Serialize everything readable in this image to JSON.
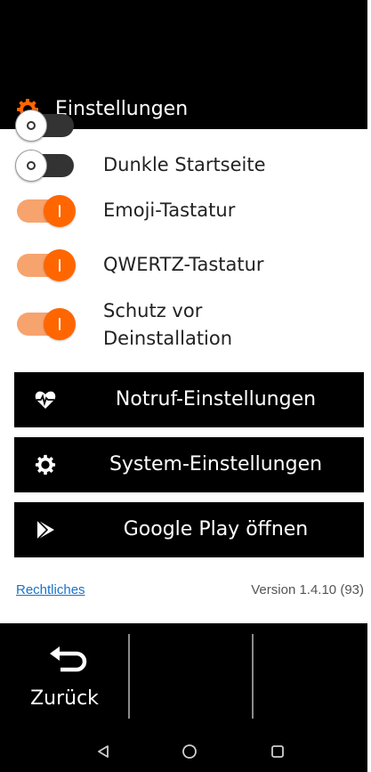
{
  "header": {
    "title": "Einstellungen",
    "icon": "gear-icon",
    "accent": "#ff6600"
  },
  "settings": {
    "items": [
      {
        "label": "Dunkle Startseite",
        "state": "off"
      },
      {
        "label": "Emoji-Tastatur",
        "state": "on"
      },
      {
        "label": "QWERTZ-Tastatur",
        "state": "on"
      },
      {
        "label": "Schutz vor",
        "label2": "Deinstallation",
        "state": "on"
      }
    ]
  },
  "buttons": {
    "emergency": {
      "label": "Notruf-Einstellungen",
      "icon": "heart-pulse-icon"
    },
    "system": {
      "label": "System-Einstellungen",
      "icon": "gear-icon"
    },
    "play": {
      "label": "Google Play öffnen",
      "icon": "play-store-icon"
    }
  },
  "footer": {
    "legal": "Rechtliches",
    "version": "Version 1.4.10 (93)"
  },
  "nav": {
    "back_label": "Zurück"
  },
  "colors": {
    "toggle_on_track": "#f7a36e",
    "toggle_on_knob": "#ff6600",
    "link": "#1a73c8"
  }
}
